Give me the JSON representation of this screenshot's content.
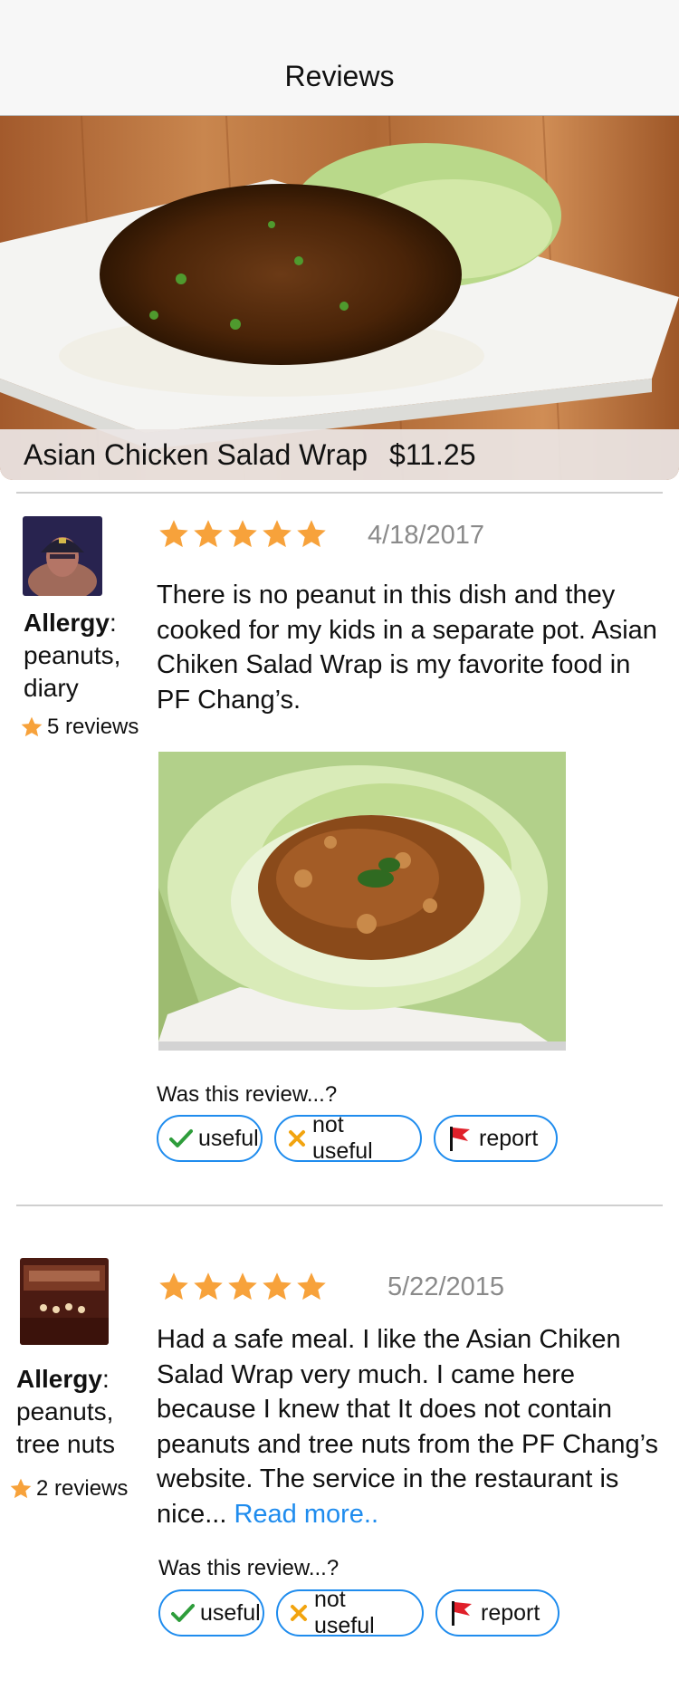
{
  "header": {
    "title": "Reviews"
  },
  "item": {
    "name": "Asian Chicken Salad Wrap",
    "price": "$11.25"
  },
  "reviews": [
    {
      "rating": 5,
      "date": "4/18/2017",
      "allergy_label": "Allergy",
      "allergy_colon": ":",
      "allergy_items": "peanuts, diary",
      "review_count": "5 reviews",
      "text": "There is no peanut in this dish and they cooked for my kids in a separate pot. Asian Chiken Salad Wrap is my favorite food in PF Chang’s.",
      "feedback_prompt": "Was this review...?",
      "buttons": {
        "useful": "useful",
        "not_useful": "not useful",
        "report": "report"
      }
    },
    {
      "rating": 5,
      "date": "5/22/2015",
      "allergy_label": "Allergy",
      "allergy_colon": ":",
      "allergy_items": "peanuts, tree nuts",
      "review_count": "2 reviews",
      "text": "Had a safe meal. I like the Asian Chiken Salad Wrap very much. I came here because I knew that It does not contain peanuts and tree nuts from the PF Chang’s website. The service in the restaurant is nice...",
      "read_more": "Read more..",
      "feedback_prompt": "Was this review...?",
      "buttons": {
        "useful": "useful",
        "not_useful": "not useful",
        "report": "report"
      }
    }
  ],
  "colors": {
    "accent": "#1f8cee",
    "star": "#f7a23b",
    "check": "#2e9d3b",
    "cross": "#f2a40f",
    "flag": "#e0202a"
  },
  "icons": [
    "star-icon",
    "check-icon",
    "cross-icon",
    "flag-icon"
  ]
}
